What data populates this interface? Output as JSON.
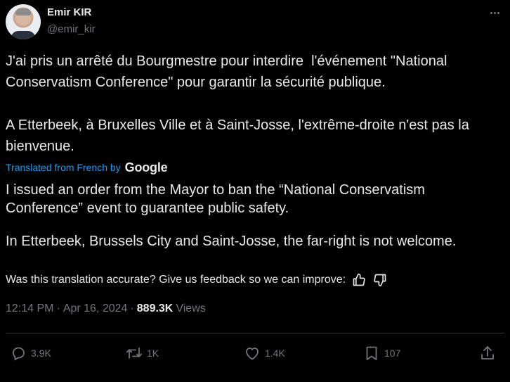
{
  "author": {
    "name": "Emir KIR",
    "handle": "@emir_kir"
  },
  "original": {
    "paragraph1": "J'ai pris un arrêté du Bourgmestre pour interdire  l'événement \"National Conservatism Conference\" pour garantir la sécurité publique.",
    "paragraph2": "A Etterbeek, à Bruxelles Ville et à Saint-Josse, l'extrême-droite n'est pas la bienvenue."
  },
  "translation": {
    "attribution": "Translated from French by",
    "provider": "Google",
    "paragraph1": "I issued an order from the Mayor to ban the “National Conservatism Conference” event to guarantee public safety.",
    "paragraph2": "In Etterbeek, Brussels City and Saint-Josse, the far-right is not welcome.",
    "feedback": "Was this translation accurate? Give us feedback so we can improve:"
  },
  "meta": {
    "time": "12:14 PM",
    "separator": "·",
    "date": "Apr 16, 2024",
    "views_count": "889.3K",
    "views_label": "Views"
  },
  "actions": {
    "replies": "3.9K",
    "reposts": "1K",
    "likes": "1.4K",
    "bookmarks": "107"
  },
  "icons": [
    "more-icon",
    "thumbs-up-icon",
    "thumbs-down-icon",
    "reply-icon",
    "repost-icon",
    "like-icon",
    "bookmark-icon",
    "share-icon"
  ],
  "colors": {
    "background": "#000000",
    "text": "#e7e9ea",
    "muted": "#71767b",
    "link": "#1d9bf0",
    "divider": "#2f3336"
  }
}
